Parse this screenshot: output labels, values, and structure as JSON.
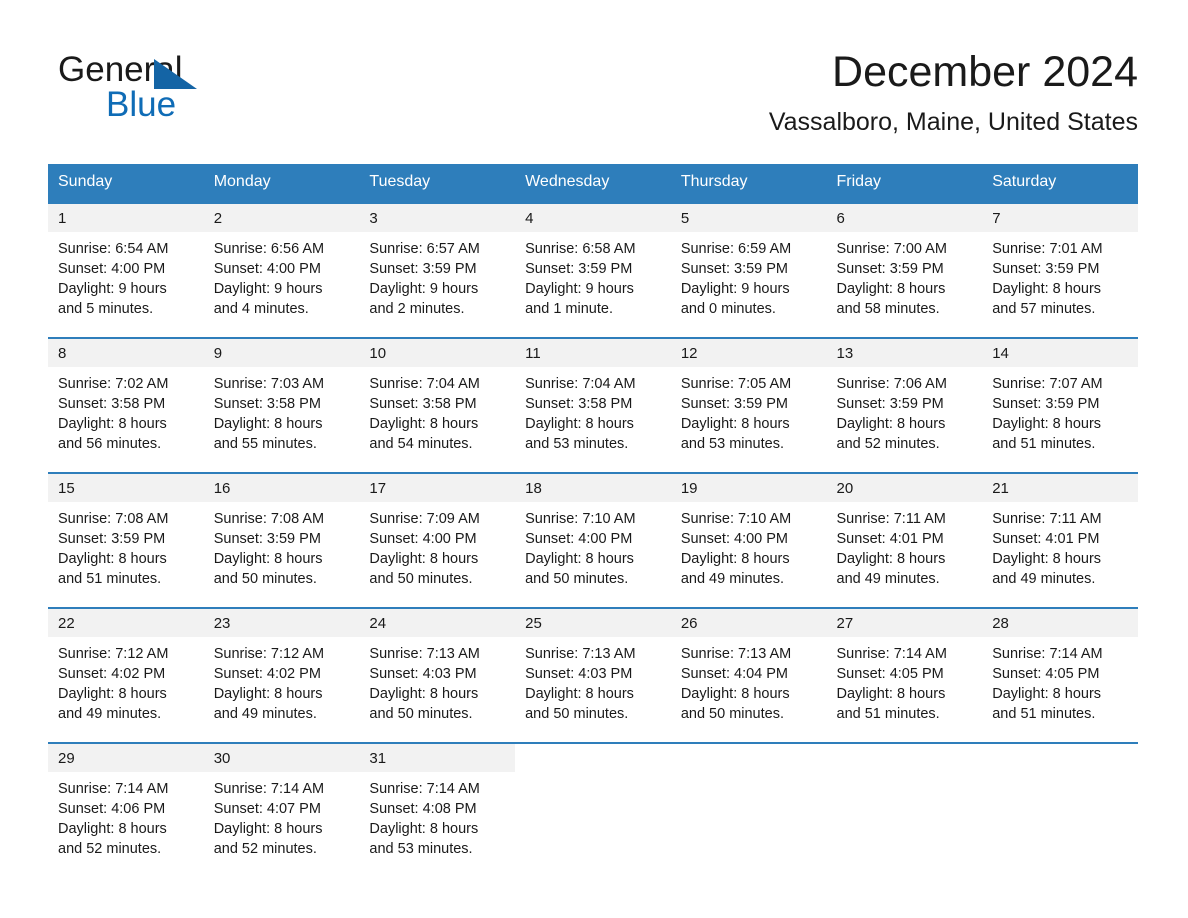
{
  "brand": {
    "name_top": "General",
    "name_bottom": "Blue",
    "triangle_color": "#1464a5",
    "blue_text_color": "#0f6cb6"
  },
  "header": {
    "month_title": "December 2024",
    "location": "Vassalboro, Maine, United States"
  },
  "theme": {
    "header_blue": "#2e7ebb",
    "daynum_band": "#f2f2f2",
    "text": "#1a1a1a"
  },
  "calendar": {
    "weekday_headers": [
      "Sunday",
      "Monday",
      "Tuesday",
      "Wednesday",
      "Thursday",
      "Friday",
      "Saturday"
    ],
    "weeks": [
      [
        {
          "day": "1",
          "sunrise": "Sunrise: 6:54 AM",
          "sunset": "Sunset: 4:00 PM",
          "daylight_1": "Daylight: 9 hours",
          "daylight_2": "and 5 minutes."
        },
        {
          "day": "2",
          "sunrise": "Sunrise: 6:56 AM",
          "sunset": "Sunset: 4:00 PM",
          "daylight_1": "Daylight: 9 hours",
          "daylight_2": "and 4 minutes."
        },
        {
          "day": "3",
          "sunrise": "Sunrise: 6:57 AM",
          "sunset": "Sunset: 3:59 PM",
          "daylight_1": "Daylight: 9 hours",
          "daylight_2": "and 2 minutes."
        },
        {
          "day": "4",
          "sunrise": "Sunrise: 6:58 AM",
          "sunset": "Sunset: 3:59 PM",
          "daylight_1": "Daylight: 9 hours",
          "daylight_2": "and 1 minute."
        },
        {
          "day": "5",
          "sunrise": "Sunrise: 6:59 AM",
          "sunset": "Sunset: 3:59 PM",
          "daylight_1": "Daylight: 9 hours",
          "daylight_2": "and 0 minutes."
        },
        {
          "day": "6",
          "sunrise": "Sunrise: 7:00 AM",
          "sunset": "Sunset: 3:59 PM",
          "daylight_1": "Daylight: 8 hours",
          "daylight_2": "and 58 minutes."
        },
        {
          "day": "7",
          "sunrise": "Sunrise: 7:01 AM",
          "sunset": "Sunset: 3:59 PM",
          "daylight_1": "Daylight: 8 hours",
          "daylight_2": "and 57 minutes."
        }
      ],
      [
        {
          "day": "8",
          "sunrise": "Sunrise: 7:02 AM",
          "sunset": "Sunset: 3:58 PM",
          "daylight_1": "Daylight: 8 hours",
          "daylight_2": "and 56 minutes."
        },
        {
          "day": "9",
          "sunrise": "Sunrise: 7:03 AM",
          "sunset": "Sunset: 3:58 PM",
          "daylight_1": "Daylight: 8 hours",
          "daylight_2": "and 55 minutes."
        },
        {
          "day": "10",
          "sunrise": "Sunrise: 7:04 AM",
          "sunset": "Sunset: 3:58 PM",
          "daylight_1": "Daylight: 8 hours",
          "daylight_2": "and 54 minutes."
        },
        {
          "day": "11",
          "sunrise": "Sunrise: 7:04 AM",
          "sunset": "Sunset: 3:58 PM",
          "daylight_1": "Daylight: 8 hours",
          "daylight_2": "and 53 minutes."
        },
        {
          "day": "12",
          "sunrise": "Sunrise: 7:05 AM",
          "sunset": "Sunset: 3:59 PM",
          "daylight_1": "Daylight: 8 hours",
          "daylight_2": "and 53 minutes."
        },
        {
          "day": "13",
          "sunrise": "Sunrise: 7:06 AM",
          "sunset": "Sunset: 3:59 PM",
          "daylight_1": "Daylight: 8 hours",
          "daylight_2": "and 52 minutes."
        },
        {
          "day": "14",
          "sunrise": "Sunrise: 7:07 AM",
          "sunset": "Sunset: 3:59 PM",
          "daylight_1": "Daylight: 8 hours",
          "daylight_2": "and 51 minutes."
        }
      ],
      [
        {
          "day": "15",
          "sunrise": "Sunrise: 7:08 AM",
          "sunset": "Sunset: 3:59 PM",
          "daylight_1": "Daylight: 8 hours",
          "daylight_2": "and 51 minutes."
        },
        {
          "day": "16",
          "sunrise": "Sunrise: 7:08 AM",
          "sunset": "Sunset: 3:59 PM",
          "daylight_1": "Daylight: 8 hours",
          "daylight_2": "and 50 minutes."
        },
        {
          "day": "17",
          "sunrise": "Sunrise: 7:09 AM",
          "sunset": "Sunset: 4:00 PM",
          "daylight_1": "Daylight: 8 hours",
          "daylight_2": "and 50 minutes."
        },
        {
          "day": "18",
          "sunrise": "Sunrise: 7:10 AM",
          "sunset": "Sunset: 4:00 PM",
          "daylight_1": "Daylight: 8 hours",
          "daylight_2": "and 50 minutes."
        },
        {
          "day": "19",
          "sunrise": "Sunrise: 7:10 AM",
          "sunset": "Sunset: 4:00 PM",
          "daylight_1": "Daylight: 8 hours",
          "daylight_2": "and 49 minutes."
        },
        {
          "day": "20",
          "sunrise": "Sunrise: 7:11 AM",
          "sunset": "Sunset: 4:01 PM",
          "daylight_1": "Daylight: 8 hours",
          "daylight_2": "and 49 minutes."
        },
        {
          "day": "21",
          "sunrise": "Sunrise: 7:11 AM",
          "sunset": "Sunset: 4:01 PM",
          "daylight_1": "Daylight: 8 hours",
          "daylight_2": "and 49 minutes."
        }
      ],
      [
        {
          "day": "22",
          "sunrise": "Sunrise: 7:12 AM",
          "sunset": "Sunset: 4:02 PM",
          "daylight_1": "Daylight: 8 hours",
          "daylight_2": "and 49 minutes."
        },
        {
          "day": "23",
          "sunrise": "Sunrise: 7:12 AM",
          "sunset": "Sunset: 4:02 PM",
          "daylight_1": "Daylight: 8 hours",
          "daylight_2": "and 49 minutes."
        },
        {
          "day": "24",
          "sunrise": "Sunrise: 7:13 AM",
          "sunset": "Sunset: 4:03 PM",
          "daylight_1": "Daylight: 8 hours",
          "daylight_2": "and 50 minutes."
        },
        {
          "day": "25",
          "sunrise": "Sunrise: 7:13 AM",
          "sunset": "Sunset: 4:03 PM",
          "daylight_1": "Daylight: 8 hours",
          "daylight_2": "and 50 minutes."
        },
        {
          "day": "26",
          "sunrise": "Sunrise: 7:13 AM",
          "sunset": "Sunset: 4:04 PM",
          "daylight_1": "Daylight: 8 hours",
          "daylight_2": "and 50 minutes."
        },
        {
          "day": "27",
          "sunrise": "Sunrise: 7:14 AM",
          "sunset": "Sunset: 4:05 PM",
          "daylight_1": "Daylight: 8 hours",
          "daylight_2": "and 51 minutes."
        },
        {
          "day": "28",
          "sunrise": "Sunrise: 7:14 AM",
          "sunset": "Sunset: 4:05 PM",
          "daylight_1": "Daylight: 8 hours",
          "daylight_2": "and 51 minutes."
        }
      ],
      [
        {
          "day": "29",
          "sunrise": "Sunrise: 7:14 AM",
          "sunset": "Sunset: 4:06 PM",
          "daylight_1": "Daylight: 8 hours",
          "daylight_2": "and 52 minutes."
        },
        {
          "day": "30",
          "sunrise": "Sunrise: 7:14 AM",
          "sunset": "Sunset: 4:07 PM",
          "daylight_1": "Daylight: 8 hours",
          "daylight_2": "and 52 minutes."
        },
        {
          "day": "31",
          "sunrise": "Sunrise: 7:14 AM",
          "sunset": "Sunset: 4:08 PM",
          "daylight_1": "Daylight: 8 hours",
          "daylight_2": "and 53 minutes."
        },
        {
          "day": "",
          "sunrise": "",
          "sunset": "",
          "daylight_1": "",
          "daylight_2": ""
        },
        {
          "day": "",
          "sunrise": "",
          "sunset": "",
          "daylight_1": "",
          "daylight_2": ""
        },
        {
          "day": "",
          "sunrise": "",
          "sunset": "",
          "daylight_1": "",
          "daylight_2": ""
        },
        {
          "day": "",
          "sunrise": "",
          "sunset": "",
          "daylight_1": "",
          "daylight_2": ""
        }
      ]
    ]
  }
}
